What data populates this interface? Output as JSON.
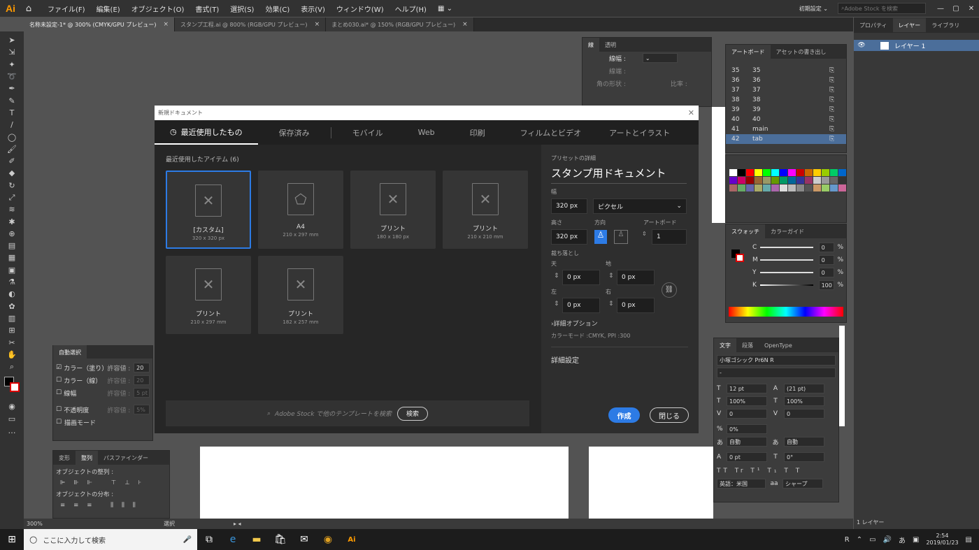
{
  "menubar": {
    "logo": "Ai",
    "items": [
      "ファイル(F)",
      "編集(E)",
      "オブジェクト(O)",
      "書式(T)",
      "選択(S)",
      "効果(C)",
      "表示(V)",
      "ウィンドウ(W)",
      "ヘルプ(H)"
    ],
    "workspace": "初期設定",
    "stock_placeholder": "Adobe Stock を検索"
  },
  "tabs": [
    "名称未設定-1* @ 300% (CMYK/GPU プレビュー)",
    "スタンプ工程.ai @ 800% (RGB/GPU プレビュー)",
    "まとめ030.ai* @ 150% (RGB/GPU プレビュー)"
  ],
  "stroke_panel": {
    "tabs": [
      "線",
      "透明"
    ],
    "weight_label": "線幅 :",
    "join_label": "線端 :",
    "corner_label": "角の形状 :",
    "ratio_label": "比率 :"
  },
  "artboard_panel": {
    "tabs": [
      "アートボード",
      "アセットの書き出し"
    ],
    "rows": [
      {
        "n": "35",
        "name": "35"
      },
      {
        "n": "36",
        "name": "36"
      },
      {
        "n": "37",
        "name": "37"
      },
      {
        "n": "38",
        "name": "38"
      },
      {
        "n": "39",
        "name": "39"
      },
      {
        "n": "40",
        "name": "40"
      },
      {
        "n": "41",
        "name": "main"
      },
      {
        "n": "42",
        "name": "tab"
      }
    ]
  },
  "right_panel": {
    "tabs": [
      "プロパティ",
      "レイヤー",
      "ライブラリ"
    ],
    "layer": "レイヤー 1",
    "footer": "1 レイヤー"
  },
  "color_panel": {
    "tabs": [
      "スウォッチ",
      "カラーガイド"
    ],
    "channels": [
      {
        "k": "C",
        "v": "0"
      },
      {
        "k": "M",
        "v": "0"
      },
      {
        "k": "Y",
        "v": "0"
      },
      {
        "k": "K",
        "v": "100"
      }
    ],
    "unit": "%"
  },
  "char_panel": {
    "tabs": [
      "文字",
      "段落",
      "OpenType"
    ],
    "font": "小塚ゴシック Pr6N R",
    "style": "-",
    "size": "12 pt",
    "leading": "(21 pt)",
    "hscale": "100%",
    "vscale": "100%",
    "tracking": "0",
    "kerning": "0",
    "tsume": "0%",
    "aki_l": "自動",
    "aki_r": "自動",
    "baseline": "0 pt",
    "rotate": "0°",
    "lang": "英語：米国",
    "aa": "シャープ"
  },
  "autoselect_panel": {
    "title": "自動選択",
    "items": [
      {
        "label": "カラー（塗り）",
        "tol": "許容値 :",
        "val": "20",
        "checked": true
      },
      {
        "label": "カラー（線）",
        "tol": "許容値 :",
        "val": "20",
        "checked": false
      },
      {
        "label": "線幅",
        "tol": "許容値 :",
        "val": "5 pt",
        "checked": false
      },
      {
        "label": "不透明度",
        "tol": "許容値 :",
        "val": "5%",
        "checked": false
      },
      {
        "label": "描画モード",
        "tol": "",
        "val": "",
        "checked": false
      }
    ]
  },
  "align_panel": {
    "tabs": [
      "変形",
      "整列",
      "パスファインダー"
    ],
    "sec1": "オブジェクトの整列 :",
    "sec2": "オブジェクトの分布 :"
  },
  "status": {
    "zoom": "300%",
    "mode": "選択"
  },
  "dialog": {
    "title": "新規ドキュメント",
    "nav": [
      "最近使用したもの",
      "保存済み",
      "モバイル",
      "Web",
      "印刷",
      "フィルムとビデオ",
      "アートとイラスト"
    ],
    "recent_label": "最近使用したアイテム",
    "recent_count": "(6)",
    "cards": [
      {
        "name": "[カスタム]",
        "size": "320 x 320 px"
      },
      {
        "name": "A4",
        "size": "210 x 297 mm"
      },
      {
        "name": "プリント",
        "size": "180 x 180 px"
      },
      {
        "name": "プリント",
        "size": "210 x 210 mm"
      },
      {
        "name": "プリント",
        "size": "210 x 297 mm"
      },
      {
        "name": "プリント",
        "size": "182 x 257 mm"
      }
    ],
    "search_placeholder": "Adobe Stock で他のテンプレートを検索",
    "search_btn": "検索",
    "preset_label": "プリセットの詳細",
    "preset_name": "スタンプ用ドキュメント",
    "width_label": "幅",
    "width_val": "320 px",
    "unit": "ピクセル",
    "height_label": "高さ",
    "height_val": "320 px",
    "orient_label": "方向",
    "artboard_label": "アートボード",
    "artboard_val": "1",
    "bleed_label": "裁ち落とし",
    "top_label": "天",
    "bottom_label": "地",
    "left_label": "左",
    "right_label": "右",
    "bleed_val": "0 px",
    "advanced_opts": "詳細オプション",
    "color_mode": "カラーモード :CMYK, PPI :300",
    "more_settings": "詳細設定",
    "create": "作成",
    "close": "閉じる"
  },
  "taskbar": {
    "search": "ここに入力して検索",
    "time": "2:54",
    "date": "2019/01/23",
    "ime": "あ"
  }
}
